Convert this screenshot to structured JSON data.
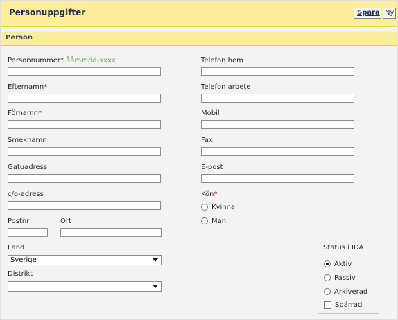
{
  "header": {
    "title": "Personuppgifter",
    "save_label": "Spara",
    "new_label": "Ny"
  },
  "section": {
    "title": "Person"
  },
  "left": {
    "personnummer": {
      "label": "Personnummer",
      "required": "*",
      "hint": "ååmmdd-xxxx",
      "value": ""
    },
    "efternamn": {
      "label": "Efternamn",
      "required": "*",
      "value": ""
    },
    "fornamn": {
      "label": "Förnamn",
      "required": "*",
      "value": ""
    },
    "smeknamn": {
      "label": "Smeknamn",
      "value": ""
    },
    "gatuadress": {
      "label": "Gatuadress",
      "value": ""
    },
    "co_adress": {
      "label": "c/o-adress",
      "value": ""
    },
    "postnr": {
      "label": "Postnr",
      "value": ""
    },
    "ort": {
      "label": "Ort",
      "value": ""
    },
    "land": {
      "label": "Land",
      "selected": "Sverige"
    },
    "distrikt": {
      "label": "Distrikt",
      "selected": ""
    }
  },
  "right": {
    "telefon_hem": {
      "label": "Telefon hem",
      "value": ""
    },
    "telefon_arbete": {
      "label": "Telefon arbete",
      "value": ""
    },
    "mobil": {
      "label": "Mobil",
      "value": ""
    },
    "fax": {
      "label": "Fax",
      "value": ""
    },
    "epost": {
      "label": "E-post",
      "value": ""
    },
    "kon": {
      "label": "Kön",
      "required": "*",
      "options": [
        "Kvinna",
        "Man"
      ]
    }
  },
  "status": {
    "legend": "Status i IDA",
    "options": [
      "Aktiv",
      "Passiv",
      "Arkiverad"
    ],
    "selected": "Aktiv",
    "sparrad_label": "Spärrad",
    "sparrad_checked": false
  }
}
